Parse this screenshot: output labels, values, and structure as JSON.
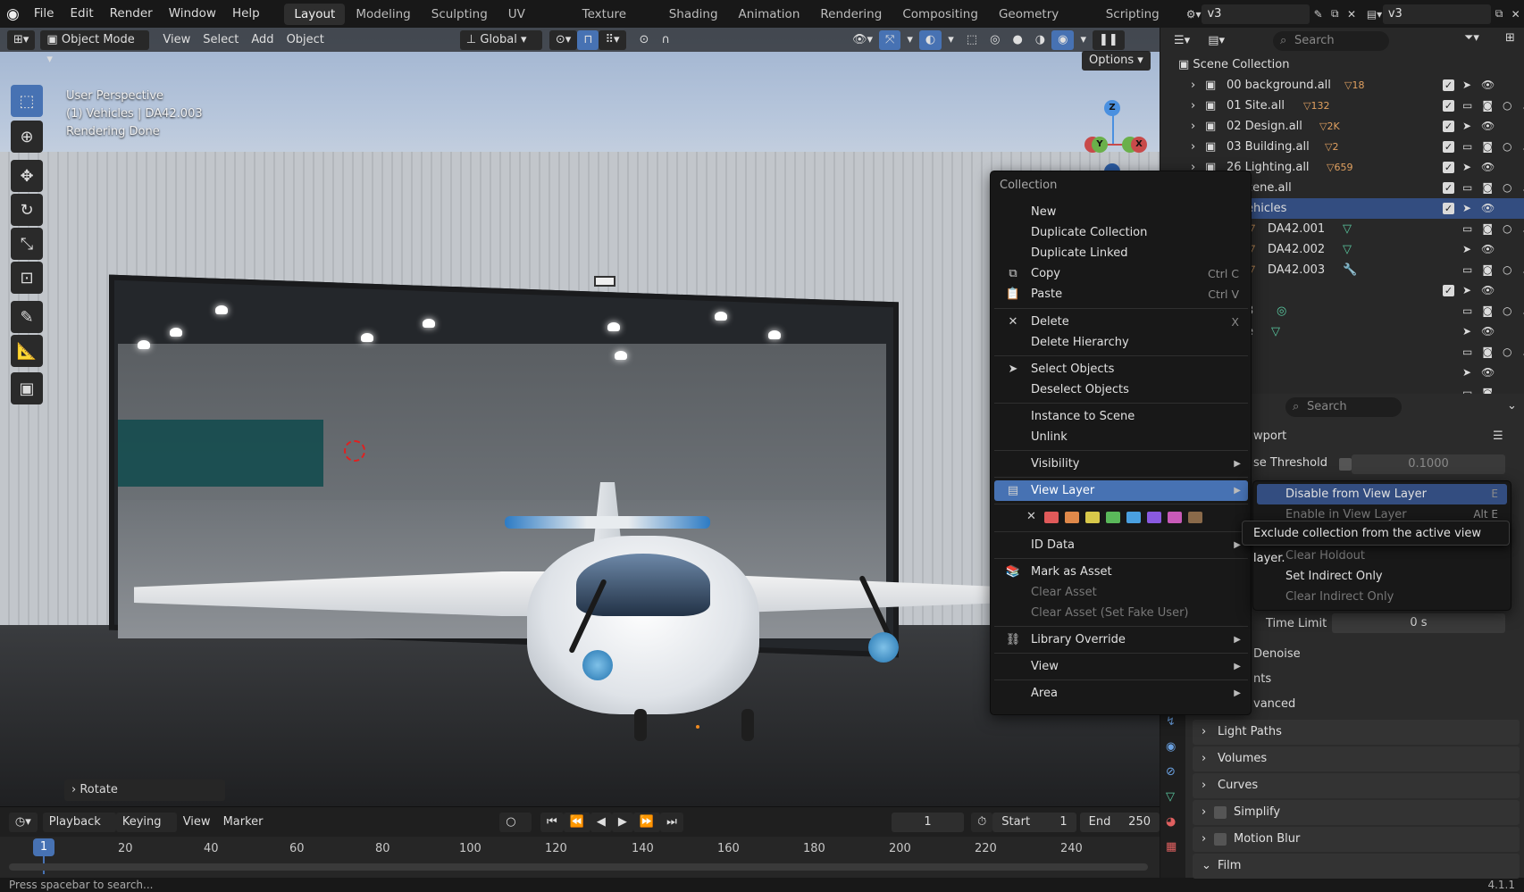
{
  "topbar": {
    "menus": [
      "File",
      "Edit",
      "Render",
      "Window",
      "Help"
    ],
    "workspaces": [
      "Layout",
      "Modeling",
      "Sculpting",
      "UV Editing",
      "Texture Paint",
      "Shading",
      "Animation",
      "Rendering",
      "Compositing",
      "Geometry Nodes",
      "Scripting"
    ],
    "active_workspace": "Layout",
    "scene_name": "v3",
    "view_layer_name": "v3"
  },
  "viewport": {
    "mode": "Object Mode",
    "menus": [
      "View",
      "Select",
      "Add",
      "Object"
    ],
    "transform_orientation": "Global",
    "options_label": "Options",
    "overlay_lines": [
      "User Perspective",
      "(1) Vehicles | DA42.003",
      "Rendering Done"
    ],
    "last_operator": "Rotate",
    "gizmo_axes": {
      "z": "Z",
      "y": "Y",
      "x": "X"
    }
  },
  "timeline": {
    "menus": [
      "Playback",
      "Keying",
      "View",
      "Marker"
    ],
    "current_frame": "1",
    "start_label": "Start",
    "start": "1",
    "end_label": "End",
    "end": "250",
    "ticks": [
      "20",
      "40",
      "60",
      "80",
      "100",
      "120",
      "140",
      "160",
      "180",
      "200",
      "220",
      "240"
    ],
    "playhead": "1"
  },
  "statusbar": {
    "hint": "Press spacebar to search...",
    "version": "4.1.1"
  },
  "outliner": {
    "search_placeholder": "Search",
    "root": "Scene Collection",
    "rows": [
      {
        "name": "00 background.all",
        "badge": "18"
      },
      {
        "name": "01 Site.all",
        "badge": "132"
      },
      {
        "name": "02 Design.all",
        "badge": "2K"
      },
      {
        "name": "03 Building.all",
        "badge": "2"
      },
      {
        "name": "26 Lighting.all",
        "badge": "659"
      },
      {
        "name": "cene.all",
        "badge": ""
      },
      {
        "name": "ehicles",
        "badge": ""
      },
      {
        "name": "DA42.001",
        "badge": ""
      },
      {
        "name": "DA42.002",
        "badge": ""
      },
      {
        "name": "DA42.003",
        "badge": ""
      },
      {
        "name": "",
        "badge": ""
      },
      {
        "name": "3",
        "badge": ""
      },
      {
        "name": "e",
        "badge": ""
      }
    ]
  },
  "properties": {
    "search_placeholder": "Search",
    "viewport_label": "wport",
    "noise_threshold_label": "se Threshold",
    "noise_threshold_value": "0.1000",
    "time_limit_label": "Time Limit",
    "time_limit_value": "0 s",
    "denoise_label": "Denoise",
    "lights_label": "nts",
    "advanced_label": "vanced",
    "panels": [
      "Light Paths",
      "Volumes",
      "Curves",
      "Simplify",
      "Motion Blur",
      "Film"
    ]
  },
  "context_menu": {
    "title": "Collection",
    "items": [
      {
        "label": "New",
        "shortcut": ""
      },
      {
        "label": "Duplicate Collection",
        "shortcut": ""
      },
      {
        "label": "Duplicate Linked",
        "shortcut": ""
      },
      {
        "label": "Copy",
        "shortcut": "Ctrl C"
      },
      {
        "label": "Paste",
        "shortcut": "Ctrl V"
      },
      {
        "label": "Delete",
        "shortcut": "X"
      },
      {
        "label": "Delete Hierarchy",
        "shortcut": ""
      },
      {
        "label": "Select Objects",
        "shortcut": ""
      },
      {
        "label": "Deselect Objects",
        "shortcut": ""
      },
      {
        "label": "Instance to Scene",
        "shortcut": ""
      },
      {
        "label": "Unlink",
        "shortcut": ""
      },
      {
        "label": "Visibility",
        "shortcut": ""
      },
      {
        "label": "View Layer",
        "shortcut": ""
      },
      {
        "label": "ID Data",
        "shortcut": ""
      },
      {
        "label": "Mark as Asset",
        "shortcut": ""
      },
      {
        "label": "Clear Asset",
        "shortcut": ""
      },
      {
        "label": "Clear Asset (Set Fake User)",
        "shortcut": ""
      },
      {
        "label": "Library Override",
        "shortcut": ""
      },
      {
        "label": "View",
        "shortcut": ""
      },
      {
        "label": "Area",
        "shortcut": ""
      }
    ],
    "color_tags": [
      "#e05a5a",
      "#e0894a",
      "#d8c84a",
      "#5ab85a",
      "#4aa0e0",
      "#8a5ae0",
      "#c85ab8",
      "#8a6a4a"
    ]
  },
  "submenu": {
    "items": [
      {
        "label": "Disable from View Layer",
        "shortcut": "E"
      },
      {
        "label": "Enable in View Layer",
        "shortcut": "Alt E"
      },
      {
        "label": "Clear Holdout",
        "shortcut": ""
      },
      {
        "label": "Set Indirect Only",
        "shortcut": ""
      },
      {
        "label": "Clear Indirect Only",
        "shortcut": ""
      }
    ]
  },
  "tooltip": {
    "text": "Exclude collection from the active view layer."
  }
}
